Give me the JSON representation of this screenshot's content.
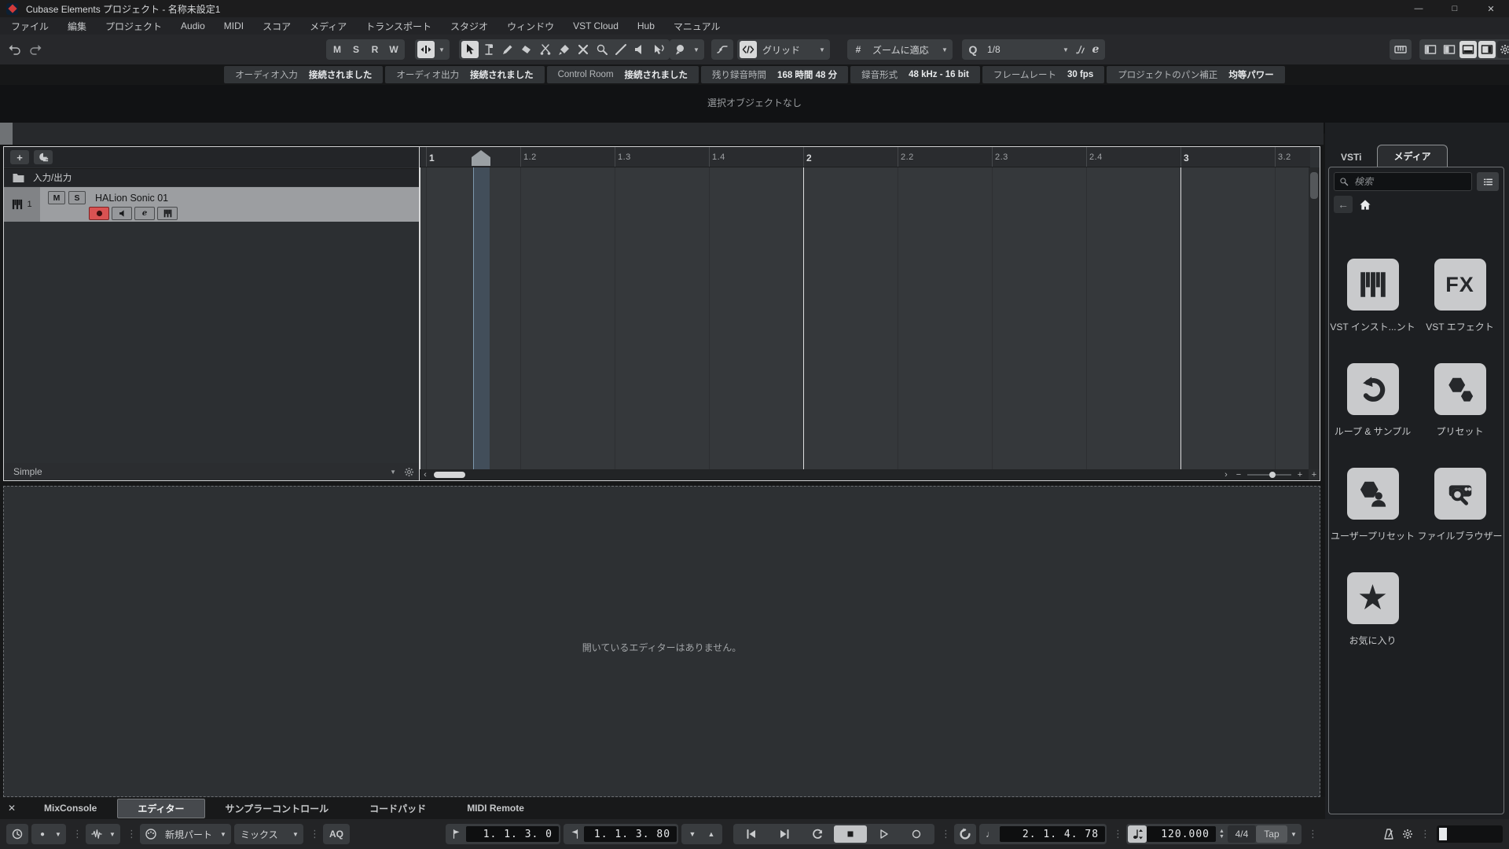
{
  "icons": {
    "dropdown": "▼",
    "kebab": "⋮",
    "minimize": "—",
    "maximize": "□",
    "close": "✕",
    "tab_close": "✕",
    "back": "←",
    "note": "♩",
    "hash": "#",
    "q": "Q",
    "hscroll_left": "‹",
    "hscroll_right": "›",
    "zoom_minus": "−",
    "zoom_plus": "+",
    "star": "★",
    "plus": "+",
    "punch_in": "▼",
    "punch_out": "▲",
    "spin_up": "▲",
    "spin_down": "▼",
    "record_dot": "●"
  },
  "title_bar": {
    "app_title": "Cubase Elements プロジェクト - 名称未設定1"
  },
  "menu_bar": {
    "items": [
      "ファイル",
      "編集",
      "プロジェクト",
      "Audio",
      "MIDI",
      "スコア",
      "メディア",
      "トランスポート",
      "スタジオ",
      "ウィンドウ",
      "VST Cloud",
      "Hub",
      "マニュアル"
    ]
  },
  "toolbar": {
    "mute": "M",
    "solo": "S",
    "read": "R",
    "write": "W",
    "snap_mode": "グリッド",
    "grid_mode": "ズームに適応",
    "quantize_value": "1/8",
    "edit": "e"
  },
  "info_bar": {
    "items": [
      {
        "label": "オーディオ入力",
        "value": "接続されました"
      },
      {
        "label": "オーディオ出力",
        "value": "接続されました"
      },
      {
        "label": "Control Room",
        "value": "接続されました"
      },
      {
        "label": "残り録音時間",
        "value": "168 時間 48 分"
      },
      {
        "label": "録音形式",
        "value": "48 kHz - 16 bit"
      },
      {
        "label": "フレームレート",
        "value": "30 fps"
      },
      {
        "label": "プロジェクトのパン補正",
        "value": "均等パワー"
      }
    ]
  },
  "status_line": {
    "message": "選択オブジェクトなし"
  },
  "track_list": {
    "folder_label": "入力/出力",
    "track_number": "1",
    "mute": "M",
    "solo": "S",
    "track_name": "HALion Sonic 01",
    "edit": "e",
    "preset_name": "Simple"
  },
  "ruler": {
    "ticks": [
      "1",
      "1.2",
      "1.3",
      "1.4",
      "2",
      "2.2",
      "2.3",
      "2.4",
      "3",
      "3.2"
    ]
  },
  "media_rack": {
    "tab_vsti": "VSTi",
    "tab_media": "メディア",
    "search_placeholder": "検索",
    "fx_label": "FX",
    "tiles": [
      "VST インスト...ント",
      "VST エフェクト",
      "ループ & サンプル",
      "プリセット",
      "ユーザープリセット",
      "ファイルブラウザー",
      "お気に入り"
    ]
  },
  "lower_zone": {
    "empty_message": "開いているエディターはありません。"
  },
  "tab_bar": {
    "tabs": [
      "MixConsole",
      "エディター",
      "サンプラーコントロール",
      "コードパッド",
      "MIDI Remote"
    ]
  },
  "transport": {
    "insert_mode": "新規パート",
    "record_mix_mode": "ミックス",
    "aq": "AQ",
    "left_locator": "1. 1. 3. 0",
    "right_locator": "1. 1. 3. 80",
    "time_display": "2. 1. 4. 78",
    "tempo": "120.000",
    "time_signature": "4/4",
    "tap": "Tap"
  }
}
